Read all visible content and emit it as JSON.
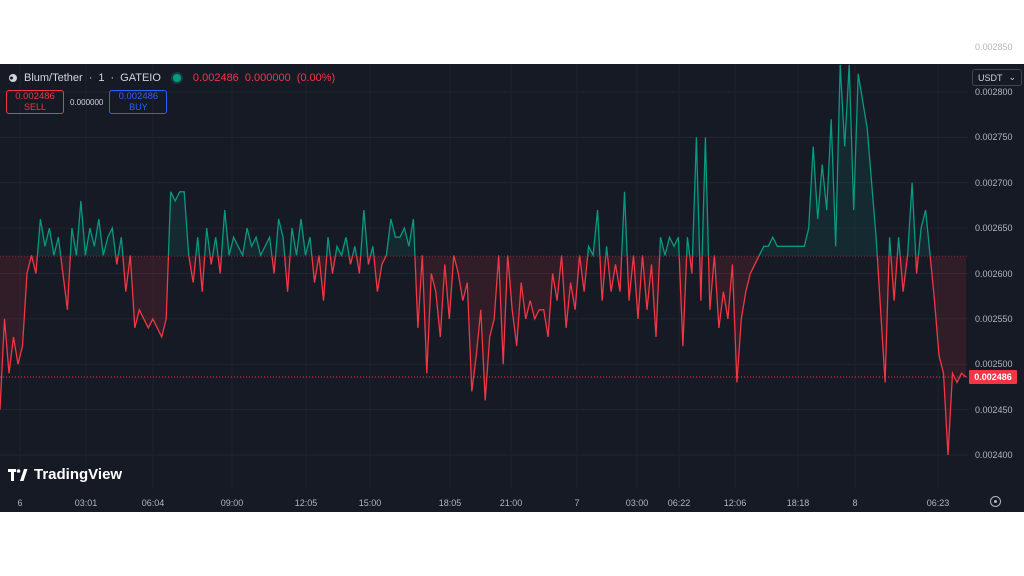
{
  "header": {
    "symbol": "Blum/Tether",
    "interval": "1",
    "exchange": "GATEIO",
    "last_price": "0.002486",
    "change": "0.000000",
    "change_pct": "(0.00%)"
  },
  "trade": {
    "sell_price": "0.002486",
    "sell_label": "SELL",
    "spread": "0.000000",
    "buy_price": "0.002486",
    "buy_label": "BUY"
  },
  "currency": "USDT",
  "price_tag": "0.002486",
  "logo_text": "TradingView",
  "colors": {
    "up": "#089981",
    "down": "#f23645",
    "background": "#161a25",
    "text": "#b2b5be"
  },
  "chart_data": {
    "type": "line",
    "title": "",
    "y_axis_ticks": [
      "0.002850",
      "0.002800",
      "0.002750",
      "0.002700",
      "0.002650",
      "0.002600",
      "0.002550",
      "0.002500",
      "0.002450",
      "0.002400"
    ],
    "x_axis_ticks": [
      "6",
      "03:01",
      "06:04",
      "09:00",
      "12:05",
      "15:00",
      "18:05",
      "21:00",
      "7",
      "03:00",
      "06:22",
      "12:06",
      "18:18",
      "8",
      "06:23"
    ],
    "ylim": [
      0.00239,
      0.00285
    ],
    "baseline": 0.002619,
    "last_value": 0.002486,
    "values": [
      0.00245,
      0.00255,
      0.00249,
      0.00253,
      0.0025,
      0.00252,
      0.0026,
      0.00262,
      0.0026,
      0.00266,
      0.00263,
      0.00265,
      0.00262,
      0.00264,
      0.0026,
      0.00256,
      0.00265,
      0.00262,
      0.00268,
      0.00262,
      0.00265,
      0.00263,
      0.00266,
      0.00262,
      0.00264,
      0.00265,
      0.00261,
      0.00264,
      0.00258,
      0.00262,
      0.00254,
      0.00256,
      0.00255,
      0.00254,
      0.00255,
      0.00254,
      0.00253,
      0.00255,
      0.00269,
      0.00268,
      0.00269,
      0.00269,
      0.00262,
      0.00259,
      0.00264,
      0.00258,
      0.00265,
      0.00261,
      0.00264,
      0.0026,
      0.00267,
      0.00262,
      0.00264,
      0.00263,
      0.00262,
      0.00265,
      0.00263,
      0.00264,
      0.00262,
      0.00263,
      0.00264,
      0.0026,
      0.00266,
      0.00264,
      0.00258,
      0.00265,
      0.00262,
      0.00266,
      0.00262,
      0.00264,
      0.00259,
      0.00262,
      0.00257,
      0.00264,
      0.0026,
      0.00263,
      0.00262,
      0.00264,
      0.00261,
      0.00263,
      0.0026,
      0.00267,
      0.00261,
      0.00263,
      0.00258,
      0.00261,
      0.00262,
      0.00266,
      0.00264,
      0.00264,
      0.00265,
      0.00263,
      0.00266,
      0.00254,
      0.00262,
      0.00249,
      0.0026,
      0.00258,
      0.00253,
      0.00261,
      0.00255,
      0.00262,
      0.0026,
      0.00257,
      0.00259,
      0.00247,
      0.00251,
      0.00256,
      0.00246,
      0.00253,
      0.00255,
      0.00262,
      0.0025,
      0.00262,
      0.00256,
      0.00252,
      0.00259,
      0.00255,
      0.00257,
      0.00255,
      0.00256,
      0.00256,
      0.00253,
      0.0026,
      0.00257,
      0.00262,
      0.00254,
      0.00259,
      0.00256,
      0.00262,
      0.00258,
      0.00263,
      0.00262,
      0.00267,
      0.00257,
      0.00263,
      0.00258,
      0.00261,
      0.00258,
      0.00269,
      0.00257,
      0.00262,
      0.00255,
      0.00262,
      0.00256,
      0.00261,
      0.00253,
      0.00264,
      0.00262,
      0.00264,
      0.00263,
      0.00264,
      0.00252,
      0.00264,
      0.0026,
      0.00275,
      0.00257,
      0.00275,
      0.00256,
      0.00262,
      0.00254,
      0.00258,
      0.00255,
      0.00261,
      0.00248,
      0.00255,
      0.00258,
      0.0026,
      0.00261,
      0.00262,
      0.00263,
      0.00263,
      0.00264,
      0.00263,
      0.00263,
      0.00263,
      0.00263,
      0.00263,
      0.00263,
      0.00263,
      0.00265,
      0.00274,
      0.00266,
      0.00272,
      0.00267,
      0.00277,
      0.00263,
      0.00283,
      0.00274,
      0.00283,
      0.00267,
      0.00282,
      0.00279,
      0.00276,
      0.0027,
      0.00264,
      0.00256,
      0.00248,
      0.00264,
      0.00257,
      0.00264,
      0.00258,
      0.00262,
      0.0027,
      0.0026,
      0.00265,
      0.00267,
      0.00262,
      0.00257,
      0.00251,
      0.00249,
      0.0024,
      0.00249,
      0.00248,
      0.00249,
      0.002486
    ]
  }
}
